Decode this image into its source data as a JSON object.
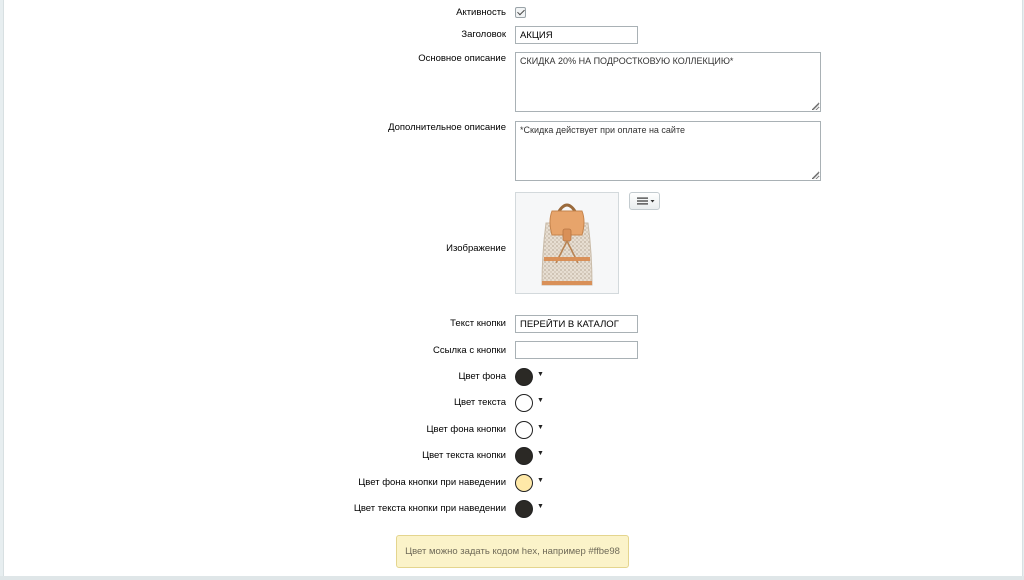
{
  "form": {
    "active_label": "Активность",
    "active_checked": true,
    "title_label": "Заголовок",
    "title_value": "АКЦИЯ",
    "main_desc_label": "Основное описание",
    "main_desc_value": "СКИДКА 20% НА ПОДРОСТКОВУЮ КОЛЛЕКЦИЮ*",
    "extra_desc_label": "Дополнительное описание",
    "extra_desc_value": "*Скидка действует при оплате на сайте",
    "image_label": "Изображение",
    "button_text_label": "Текст кнопки",
    "button_text_value": "ПЕРЕЙТИ В КАТАЛОГ",
    "button_link_label": "Ссылка с кнопки",
    "button_link_value": ""
  },
  "colors": [
    {
      "label": "Цвет фона",
      "value": "#2b2925"
    },
    {
      "label": "Цвет текста",
      "value": "#ffffff"
    },
    {
      "label": "Цвет фона кнопки",
      "value": "#ffffff"
    },
    {
      "label": "Цвет текста кнопки",
      "value": "#2b2925"
    },
    {
      "label": "Цвет фона кнопки при наведении",
      "value": "#ffe9a8"
    },
    {
      "label": "Цвет текста кнопки при наведении",
      "value": "#2b2925"
    }
  ],
  "hint": {
    "text": "Цвет можно задать кодом hex, например #ffbe98"
  },
  "icons": {
    "menu": "hamburger-menu-icon",
    "dropdown": "caret-down-icon",
    "image": "backpack-image"
  }
}
